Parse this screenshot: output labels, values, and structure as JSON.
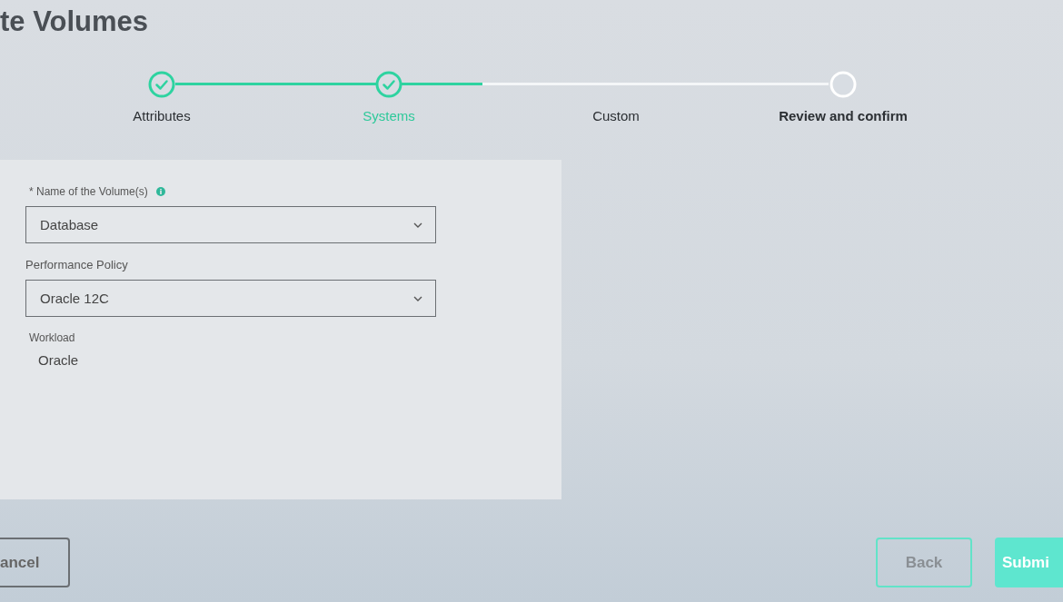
{
  "title": "te Volumes",
  "stepper": {
    "level": 0.47,
    "steps": [
      {
        "label": "Attributes",
        "kind": "done",
        "selected": false,
        "bold": false
      },
      {
        "label": "Systems",
        "kind": "done",
        "selected": true,
        "bold": false
      },
      {
        "label": "Custom",
        "kind": "plain",
        "selected": false,
        "bold": false
      },
      {
        "label": "Review and confirm",
        "kind": "open",
        "selected": false,
        "bold": true
      }
    ]
  },
  "form": {
    "fields": [
      {
        "kind": "select",
        "label": "* Name of the Volume(s)",
        "info": true,
        "value": "Database"
      },
      {
        "kind": "select",
        "label": "Performance Policy",
        "info": false,
        "value": "Oracle 12C"
      },
      {
        "kind": "text",
        "label": "Workload",
        "info": false,
        "value": "Oracle"
      }
    ]
  },
  "buttons": [
    {
      "label": "ancel",
      "kind": "cancel"
    },
    {
      "label": "Back",
      "kind": "secondary"
    },
    {
      "label": "Submi",
      "kind": "primary"
    }
  ]
}
